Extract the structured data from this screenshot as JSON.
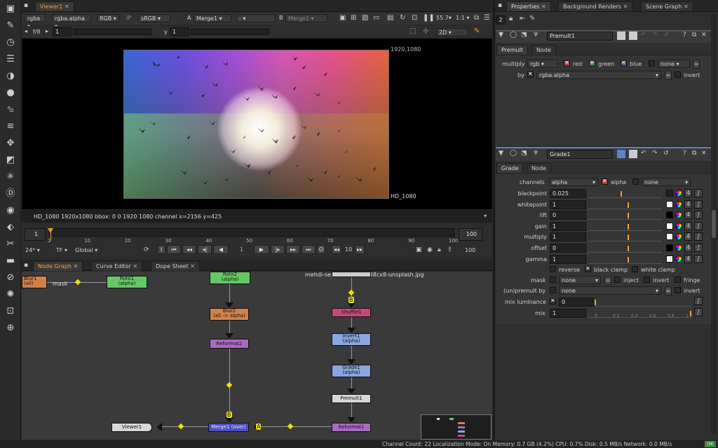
{
  "viewer": {
    "tab": "Viewer1",
    "channels": "rgba",
    "layer": "rgba.alpha",
    "colorspace_mode": "RGB",
    "ip": "IP",
    "lut": "sRGB",
    "a_label": "A",
    "a_input": "Merge1",
    "dash": "-",
    "b_label": "B",
    "b_input": "Merge1",
    "zoom": "55.7",
    "ratio": "1:1",
    "fstop": "f/8",
    "frame_field": "1",
    "gamma_label": "y",
    "gamma_field": "1",
    "view_mode": "2D",
    "format_top": "1920,1080",
    "format_corner": "HD_1080",
    "info_line": "HD_1080 1920x1080  bbox: 0 0 1920 1080 channel  x=2156 y=425"
  },
  "timeline": {
    "start": "1",
    "end": "100",
    "end_field": "100",
    "ticks": [
      "1",
      "10",
      "20",
      "30",
      "40",
      "50",
      "60",
      "70",
      "80",
      "90",
      "100"
    ],
    "fps": "24*",
    "tf": "TF",
    "global": "Global",
    "current_frame": "1",
    "step": "10"
  },
  "node_graph": {
    "tabs": [
      "Node Graph",
      "Curve Editor",
      "Dope Sheet"
    ],
    "nodes": {
      "blur1": "Blur1\n(all)",
      "roto1": "Roto1\n(alpha)",
      "roto2": "Roto2\n(alpha)",
      "blur2": "Blur2\n(all -> alpha)",
      "reformat2": "Reformat2",
      "read": "mehdi-sepehri-cX0Yxw38cx8-unsplash.jpg",
      "shuffle1": "Shuffle1",
      "invert1": "Invert1\n(alpha)",
      "grade1": "Grade1\n(alpha)",
      "premult1": "Premult1",
      "reformat1": "Reformat1",
      "merge1": "Merge1 (over)",
      "viewer1": "Viewer1"
    },
    "labels": {
      "mask": "mask",
      "b1": "B",
      "b2": "B",
      "a": "A",
      "one": "1"
    }
  },
  "properties": {
    "tabs": [
      "Properties",
      "Background Renders",
      "Scene Graph"
    ],
    "count": "2",
    "premult": {
      "name": "Premult1",
      "tabs": [
        "Premult",
        "Node"
      ],
      "multiply_label": "multiply",
      "multiply_value": "rgb",
      "red": "red",
      "green": "green",
      "blue": "blue",
      "none": "none",
      "by_label": "by",
      "by_value": "rgba.alpha",
      "invert": "invert"
    },
    "grade": {
      "name": "Grade1",
      "tabs": [
        "Grade",
        "Node"
      ],
      "channels_label": "channels",
      "channels_value": "alpha",
      "alpha": "alpha",
      "none": "none",
      "rows": [
        {
          "label": "blackpoint",
          "value": "0.025",
          "n": "4"
        },
        {
          "label": "whitepoint",
          "value": "1",
          "n": "4"
        },
        {
          "label": "lift",
          "value": "0",
          "n": "4"
        },
        {
          "label": "gain",
          "value": "1",
          "n": "4"
        },
        {
          "label": "multiply",
          "value": "1",
          "n": "4"
        },
        {
          "label": "offset",
          "value": "0",
          "n": "4"
        },
        {
          "label": "gamma",
          "value": "1",
          "n": "4"
        }
      ],
      "reverse": "reverse",
      "black_clamp": "black clamp",
      "white_clamp": "white clamp",
      "mask_label": "mask",
      "mask_value": "none",
      "inject": "inject",
      "invert": "invert",
      "fringe": "fringe",
      "unpremult_label": "(un)premult by",
      "unpremult_value": "none",
      "invert2": "invert",
      "mixlum_label": "mix luminance",
      "mixlum_value": "0",
      "mix_label": "mix",
      "mix_value": "1",
      "slider_ticks_a": [
        "0",
        "1",
        "2",
        "3",
        "4",
        "5"
      ],
      "slider_ticks_b": [
        "0",
        "0.2",
        "0.4",
        "0.6",
        "0.8",
        "1"
      ]
    }
  },
  "status": "Channel Count: 22 Localization Mode: On Memory: 0.7 GB (4.2%) CPU: 0.7% Disk: 0.5 MB/s Network: 0.0 MB/s",
  "status_ok": "OK",
  "colors": {
    "accent": "#f0a030",
    "selected_node": "#5a84c8"
  }
}
